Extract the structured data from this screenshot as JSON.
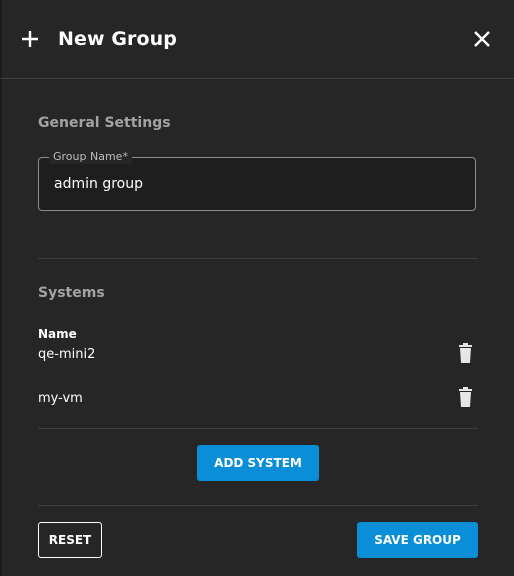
{
  "dialog": {
    "title": "New Group",
    "header_icon": "plus-icon",
    "close_icon": "close-icon"
  },
  "general_settings": {
    "section_title": "General Settings",
    "group_name_label": "Group Name*",
    "group_name_value": "admin group"
  },
  "systems": {
    "section_title": "Systems",
    "column_header": "Name",
    "rows": [
      {
        "name": "qe-mini2",
        "action_icon": "trash-icon"
      },
      {
        "name": "my-vm",
        "action_icon": "trash-icon"
      }
    ],
    "add_button_label": "ADD SYSTEM"
  },
  "footer": {
    "reset_label": "RESET",
    "save_label": "SAVE GROUP"
  },
  "colors": {
    "background": "#262626",
    "accent": "#0a8ed8",
    "muted_text": "#a3a3a3",
    "divider": "#3d3d3d"
  }
}
